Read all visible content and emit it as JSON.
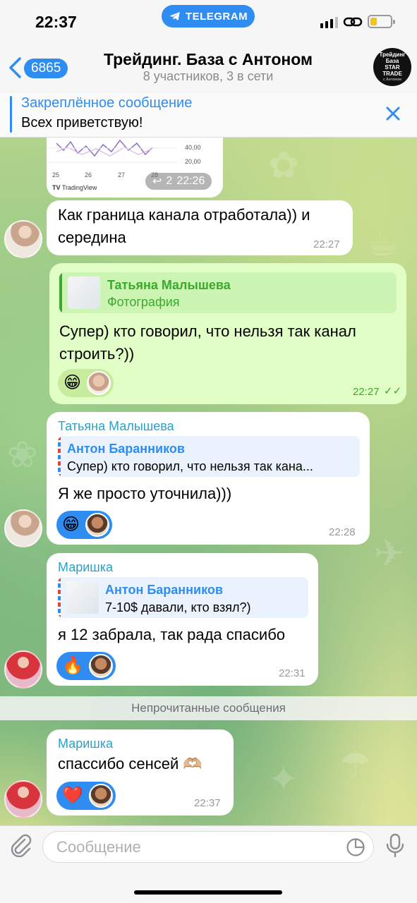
{
  "status": {
    "time": "22:37",
    "app_pill": "TELEGRAM"
  },
  "header": {
    "back_count": "6865",
    "title": "Трейдинг. База с Антоном",
    "subtitle": "8 участников, 3 в сети",
    "avatar_text": [
      "Трейдинг",
      "База",
      "STAR",
      "TRADE",
      "с Антоном"
    ]
  },
  "pinned": {
    "title": "Закреплённое сообщение",
    "text": "Всех приветствую!"
  },
  "messages": [
    {
      "chart_ticks_y": [
        "40,00",
        "20,00"
      ],
      "chart_ticks_x": [
        "25",
        "26",
        "27",
        "28"
      ],
      "chart_brand": "TradingView",
      "replies": "2",
      "time": "22:26"
    },
    {
      "text": "Как граница канала отработала)) и середина",
      "time": "22:27"
    },
    {
      "reply_name": "Татьяна Малышева",
      "reply_text": "Фотография",
      "text": "Супер) кто говорил, что нельзя так канал строить?))",
      "reaction_emoji": "😁",
      "time": "22:27"
    },
    {
      "sender": "Татьяна Малышева",
      "reply_name": "Антон Баранников",
      "reply_text": "Супер) кто говорил, что нельзя так кана...",
      "text": "Я же просто уточнила)))",
      "reaction_emoji": "😁",
      "time": "22:28"
    },
    {
      "sender": "Маришка",
      "reply_name": "Антон Баранников",
      "reply_text": "7-10$ давали, кто взял?)",
      "text": "я 12 забрала, так рада спасибо",
      "reaction_emoji": "🔥",
      "time": "22:31"
    },
    {
      "sender": "Маришка",
      "text": "спассибо сенсей 🫶🏼",
      "reaction_emoji": "❤️",
      "time": "22:37"
    }
  ],
  "unread_label": "Непрочитанные сообщения",
  "input": {
    "placeholder": "Сообщение"
  },
  "colors": {
    "accent": "#2f8cf0",
    "outgoing_bubble": "#e1fec6",
    "sender_name": "#2aa1c9"
  }
}
